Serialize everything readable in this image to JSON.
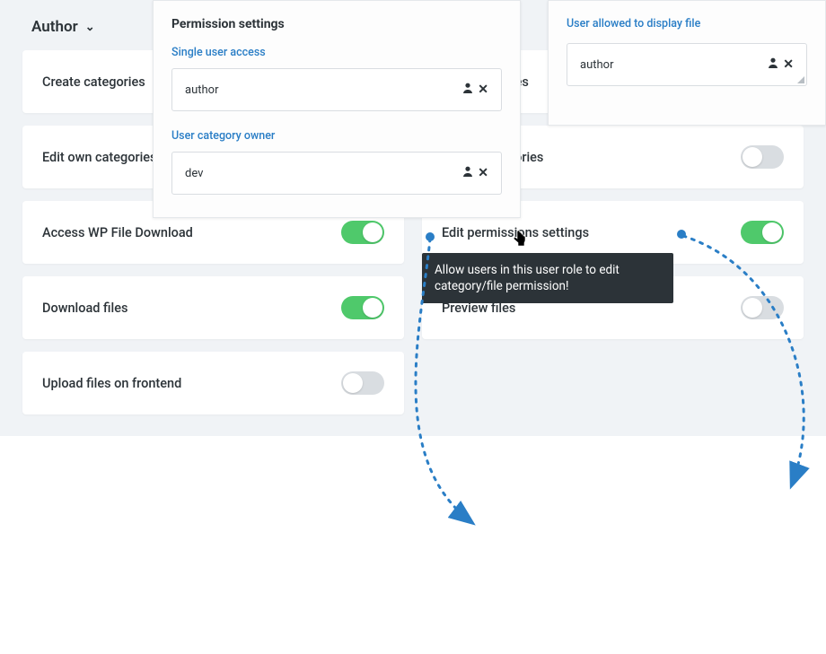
{
  "role_selector": {
    "selected": "Author"
  },
  "permissions": {
    "left": [
      {
        "label": "Create categories",
        "on": false
      },
      {
        "label": "Edit own categories",
        "on": false
      },
      {
        "label": "Access WP File Download",
        "on": true
      },
      {
        "label": "Download files",
        "on": true
      },
      {
        "label": "Upload files on frontend",
        "on": false
      }
    ],
    "right": [
      {
        "label": "Edit categories",
        "on": false
      },
      {
        "label": "Delete categories",
        "on": false
      },
      {
        "label": "Edit permissions settings",
        "on": true,
        "tooltip": "Allow users in this user role to edit category/file permission!"
      },
      {
        "label": "Preview files",
        "on": false
      }
    ]
  },
  "panel_left": {
    "title": "Permission settings",
    "single_user_label": "Single user access",
    "single_user_value": "author",
    "owner_label": "User category owner",
    "owner_value": "dev"
  },
  "panel_right": {
    "title": "User allowed to display file",
    "value": "author"
  }
}
